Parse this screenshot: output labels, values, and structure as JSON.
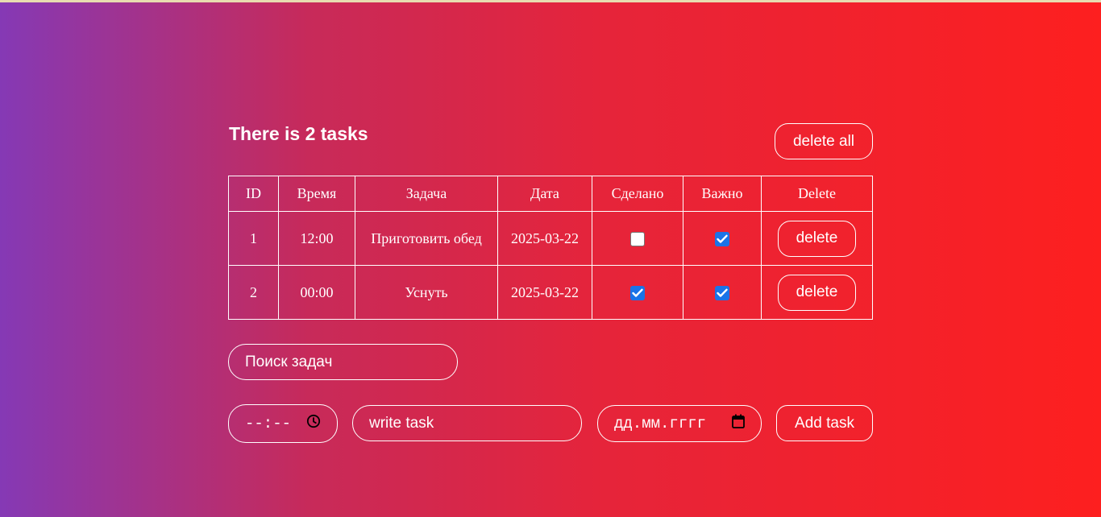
{
  "header": {
    "title": "There is 2 tasks",
    "delete_all_label": "delete all"
  },
  "table": {
    "columns": [
      "ID",
      "Время",
      "Задача",
      "Дата",
      "Сделано",
      "Важно",
      "Delete"
    ],
    "rows": [
      {
        "id": "1",
        "time": "12:00",
        "task": "Приготовить обед",
        "date": "2025-03-22",
        "done": false,
        "important": true,
        "delete_label": "delete"
      },
      {
        "id": "2",
        "time": "00:00",
        "task": "Уснуть",
        "date": "2025-03-22",
        "done": true,
        "important": true,
        "delete_label": "delete"
      }
    ]
  },
  "search": {
    "placeholder": "Поиск задач"
  },
  "add_form": {
    "time_placeholder": "--:--",
    "time_icon": "clock-icon",
    "task_placeholder": "write task",
    "date_placeholder": "дд.мм.гггг",
    "date_icon": "calendar-icon",
    "add_label": "Add task"
  },
  "colors": {
    "gradient_start": "#8539b5",
    "gradient_end": "#fd1f1f",
    "checkbox_checked": "#1a73e8",
    "top_strip": "#e8dcb0"
  }
}
